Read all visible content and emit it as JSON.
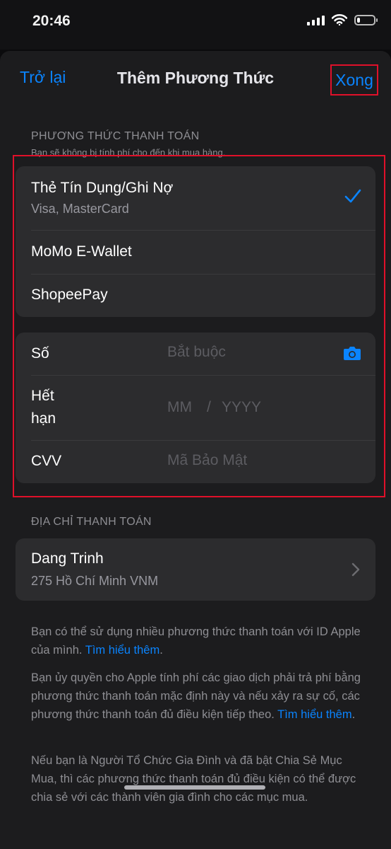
{
  "status_bar": {
    "time": "20:46",
    "battery_level": 0.2
  },
  "nav": {
    "back_label": "Trở lại",
    "title": "Thêm Phương Thức",
    "done_label": "Xong"
  },
  "payment_section": {
    "header": "PHƯƠNG THỨC THANH TOÁN",
    "subheader": "Bạn sẽ không bị tính phí cho đến khi mua hàng.",
    "methods": [
      {
        "label": "Thẻ Tín Dụng/Ghi Nợ",
        "sublabel": "Visa, MasterCard",
        "selected": true
      },
      {
        "label": "MoMo E-Wallet"
      },
      {
        "label": "ShopeePay"
      }
    ]
  },
  "card_fields": {
    "number": {
      "label": "Số",
      "placeholder": "Bắt buộc"
    },
    "expiry": {
      "label": "Hết hạn",
      "month_placeholder": "MM",
      "separator": "/",
      "year_placeholder": "YYYY"
    },
    "cvv": {
      "label": "CVV",
      "placeholder": "Mã Bảo Mật"
    }
  },
  "billing_section": {
    "header": "ĐỊA CHỈ THANH TOÁN",
    "name": "Dang Trinh",
    "address": "275 Hồ Chí Minh VNM"
  },
  "footer": {
    "p1_text": "Bạn có thể sử dụng nhiều phương thức thanh toán với ID Apple của mình.",
    "p1_link": "Tìm hiểu thêm",
    "p2_text": "Bạn ủy quyền cho Apple tính phí các giao dịch phải trả phí bằng phương thức thanh toán mặc định này và nếu xảy ra sự cố, các phương thức thanh toán đủ điều kiện tiếp theo.",
    "p2_link": "Tìm hiểu thêm",
    "p3_text": "Nếu bạn là Người Tổ Chức Gia Đình và đã bật Chia Sẻ Mục Mua, thì các phương thức thanh toán đủ điều kiện có thể được chia sẻ với các thành viên gia đình cho các mục mua."
  },
  "colors": {
    "accent": "#0a84ff",
    "highlight": "#e0102a",
    "background": "#1c1c1e",
    "cell": "#2c2c2e"
  }
}
